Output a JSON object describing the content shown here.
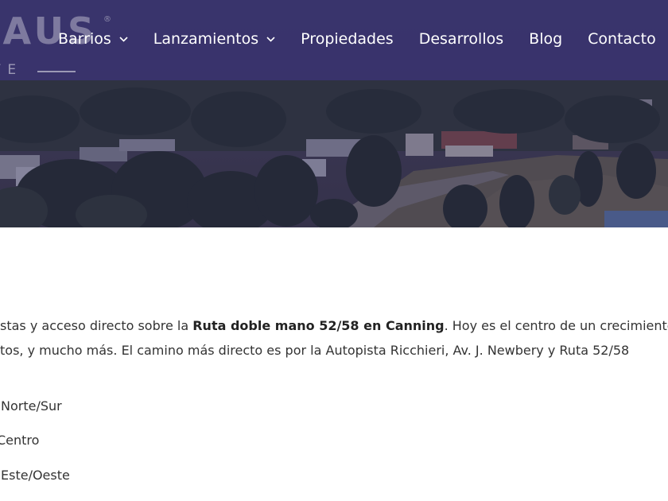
{
  "logo": {
    "word": "HAUS",
    "registered": "®",
    "sub": "TE"
  },
  "nav": {
    "items": [
      {
        "label": "Barrios",
        "has_dropdown": true,
        "icon": "chevron-down-icon"
      },
      {
        "label": "Lanzamientos",
        "has_dropdown": true,
        "icon": "chevron-down-icon"
      },
      {
        "label": "Propiedades",
        "has_dropdown": false
      },
      {
        "label": "Desarrollos",
        "has_dropdown": false
      },
      {
        "label": "Blog",
        "has_dropdown": false
      },
      {
        "label": "Contacto",
        "has_dropdown": false
      }
    ]
  },
  "content": {
    "p1_pre": "stas y acceso directo sobre la ",
    "p1_bold": "Ruta doble mano 52/58 en Canning",
    "p1_post": ". Hoy es el centro de un crecimiento",
    "p2": "tos, y mucho más. El camino más directo es por la Autopista Ricchieri, Av. J. Newbery y Ruta 52/58",
    "list": [
      "Norte/Sur",
      "Centro",
      "Este/Oeste"
    ]
  },
  "colors": {
    "header_bg": "#39346c",
    "nav_text": "#ffffff",
    "body_text": "#333333"
  }
}
